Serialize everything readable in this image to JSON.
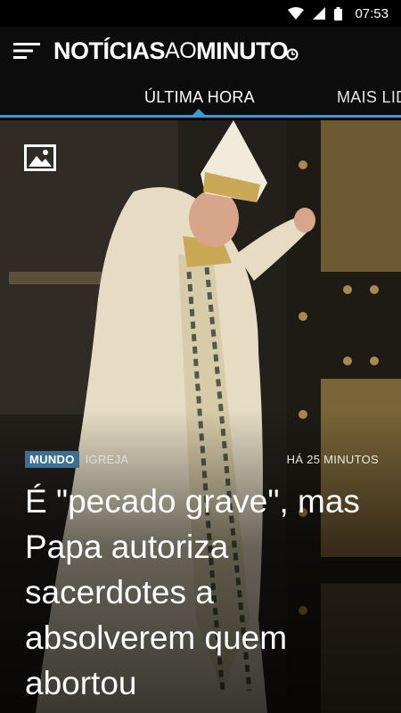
{
  "status_bar": {
    "time": "07:53",
    "icons": [
      "wifi-icon",
      "cell-signal-icon",
      "battery-icon"
    ]
  },
  "header": {
    "logo": {
      "part1": "NOTÍCIAS",
      "part2": "AO",
      "part3": "MINUTO"
    },
    "menu_icon": "hamburger-menu-icon"
  },
  "tabs": [
    {
      "label": "ÚLTIMA HORA",
      "active": true
    },
    {
      "label": "MAIS LIDAS",
      "active": false
    }
  ],
  "colors": {
    "accent": "#3a9bd8",
    "badge": "#3c6f91",
    "header_bg": "#0c0c0c"
  },
  "article": {
    "media_icon": "image-gallery-icon",
    "category": "MUNDO",
    "subcategory": "IGREJA",
    "time_ago": "HÁ 25 MINUTOS",
    "headline": "É \"pecado grave\", mas Papa autoriza sacerdotes a absolverem quem abortou"
  }
}
